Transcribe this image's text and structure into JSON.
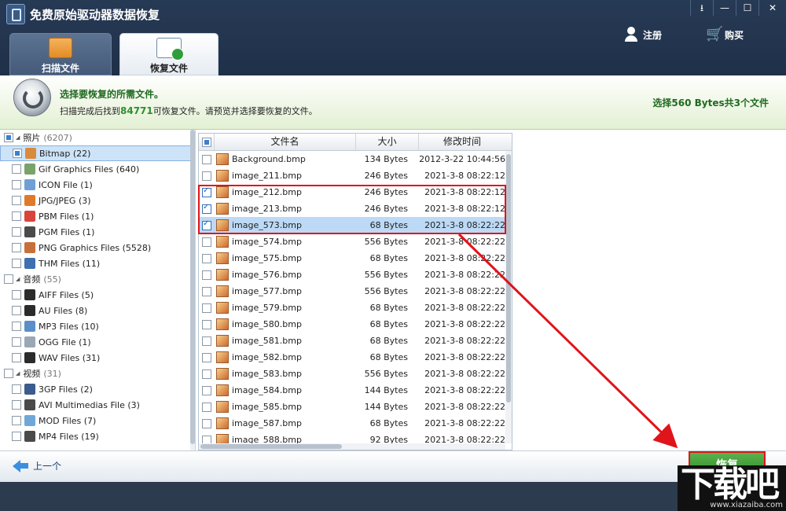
{
  "app": {
    "title": "免费原始驱动器数据恢复"
  },
  "window_buttons": [
    "⭳",
    "—",
    "☐",
    "✕"
  ],
  "header": {
    "register": "注册",
    "buy": "购买"
  },
  "tabs": [
    {
      "label": "扫描文件"
    },
    {
      "label": "恢复文件"
    }
  ],
  "info": {
    "title": "选择要恢复的所需文件。",
    "sub_prefix": "扫描完成后找到",
    "count": "84771",
    "sub_suffix": "可恢复文件。请预览并选择要恢复的文件。",
    "selection": "选择560 Bytes共3个文件"
  },
  "tree": [
    {
      "label": "照片",
      "count": "(6207)",
      "level": 0,
      "check": "partial"
    },
    {
      "label": "Bitmap (22)",
      "level": 1,
      "check": "partial",
      "selected": true,
      "icon_color": "#d98a3d"
    },
    {
      "label": "Gif Graphics Files (640)",
      "level": 1,
      "check": "none",
      "icon_color": "#7aa36b"
    },
    {
      "label": "ICON File (1)",
      "level": 1,
      "check": "none",
      "icon_color": "#6f9fd6"
    },
    {
      "label": "JPG/JPEG (3)",
      "level": 1,
      "check": "none",
      "icon_color": "#e07a2a"
    },
    {
      "label": "PBM Files (1)",
      "level": 1,
      "check": "none",
      "icon_color": "#d9453a"
    },
    {
      "label": "PGM Files (1)",
      "level": 1,
      "check": "none",
      "icon_color": "#4b4b4b"
    },
    {
      "label": "PNG Graphics Files (5528)",
      "level": 1,
      "check": "none",
      "icon_color": "#c8703a"
    },
    {
      "label": "THM Files (11)",
      "level": 1,
      "check": "none",
      "icon_color": "#3e6fb0"
    },
    {
      "label": "音频",
      "count": "(55)",
      "level": 0,
      "check": "none"
    },
    {
      "label": "AIFF Files (5)",
      "level": 1,
      "check": "none",
      "icon_color": "#2b2b2b"
    },
    {
      "label": "AU Files (8)",
      "level": 1,
      "check": "none",
      "icon_color": "#2b2b2b"
    },
    {
      "label": "MP3 Files (10)",
      "level": 1,
      "check": "none",
      "icon_color": "#5a8fc8"
    },
    {
      "label": "OGG File (1)",
      "level": 1,
      "check": "none",
      "icon_color": "#9aa7b5"
    },
    {
      "label": "WAV Files (31)",
      "level": 1,
      "check": "none",
      "icon_color": "#2b2b2b"
    },
    {
      "label": "视频",
      "count": "(31)",
      "level": 0,
      "check": "none"
    },
    {
      "label": "3GP Files (2)",
      "level": 1,
      "check": "none",
      "icon_color": "#3b5c8c"
    },
    {
      "label": "AVI Multimedias File (3)",
      "level": 1,
      "check": "none",
      "icon_color": "#4a4a4a"
    },
    {
      "label": "MOD Files (7)",
      "level": 1,
      "check": "none",
      "icon_color": "#6fa8d8"
    },
    {
      "label": "MP4 Files (19)",
      "level": 1,
      "check": "none",
      "icon_color": "#4a4a4a"
    }
  ],
  "list": {
    "headers": {
      "name": "文件名",
      "size": "大小",
      "date": "修改时间"
    },
    "rows": [
      {
        "name": "Background.bmp",
        "size": "134 Bytes",
        "date": "2012-3-22 10:44:56",
        "checked": false
      },
      {
        "name": "image_211.bmp",
        "size": "246 Bytes",
        "date": "2021-3-8 08:22:12",
        "checked": false
      },
      {
        "name": "image_212.bmp",
        "size": "246 Bytes",
        "date": "2021-3-8 08:22:12",
        "checked": true
      },
      {
        "name": "image_213.bmp",
        "size": "246 Bytes",
        "date": "2021-3-8 08:22:12",
        "checked": true
      },
      {
        "name": "image_573.bmp",
        "size": "68 Bytes",
        "date": "2021-3-8 08:22:22",
        "checked": true,
        "highlight": true
      },
      {
        "name": "image_574.bmp",
        "size": "556 Bytes",
        "date": "2021-3-8 08:22:22",
        "checked": false
      },
      {
        "name": "image_575.bmp",
        "size": "68 Bytes",
        "date": "2021-3-8 08:22:22",
        "checked": false
      },
      {
        "name": "image_576.bmp",
        "size": "556 Bytes",
        "date": "2021-3-8 08:22:22",
        "checked": false
      },
      {
        "name": "image_577.bmp",
        "size": "556 Bytes",
        "date": "2021-3-8 08:22:22",
        "checked": false
      },
      {
        "name": "image_579.bmp",
        "size": "68 Bytes",
        "date": "2021-3-8 08:22:22",
        "checked": false
      },
      {
        "name": "image_580.bmp",
        "size": "68 Bytes",
        "date": "2021-3-8 08:22:22",
        "checked": false
      },
      {
        "name": "image_581.bmp",
        "size": "68 Bytes",
        "date": "2021-3-8 08:22:22",
        "checked": false
      },
      {
        "name": "image_582.bmp",
        "size": "68 Bytes",
        "date": "2021-3-8 08:22:22",
        "checked": false
      },
      {
        "name": "image_583.bmp",
        "size": "556 Bytes",
        "date": "2021-3-8 08:22:22",
        "checked": false
      },
      {
        "name": "image_584.bmp",
        "size": "144 Bytes",
        "date": "2021-3-8 08:22:22",
        "checked": false
      },
      {
        "name": "image_585.bmp",
        "size": "144 Bytes",
        "date": "2021-3-8 08:22:22",
        "checked": false
      },
      {
        "name": "image_587.bmp",
        "size": "68 Bytes",
        "date": "2021-3-8 08:22:22",
        "checked": false
      },
      {
        "name": "image_588.bmp",
        "size": "92 Bytes",
        "date": "2021-3-8 08:22:22",
        "checked": false
      }
    ]
  },
  "bottom": {
    "prev": "上一个",
    "recover": "恢复"
  },
  "watermark": {
    "main": "下载吧",
    "sub": "www.xiazaiba.com"
  },
  "colors": {
    "accent_green": "#2c8a26",
    "highlight_red": "#e0141b",
    "title_bar": "#273a55"
  }
}
